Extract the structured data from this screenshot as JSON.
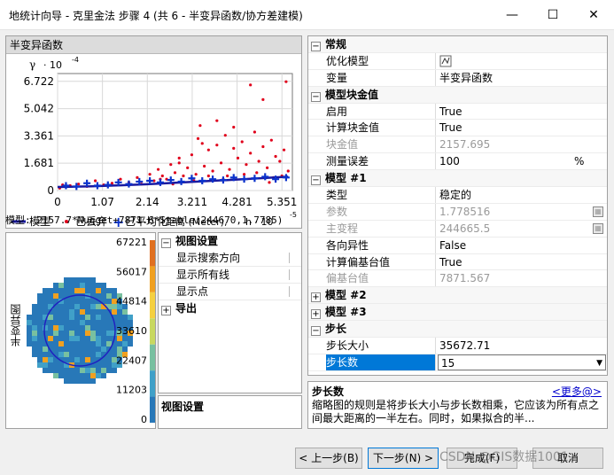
{
  "window": {
    "title": "地统计向导 - 克里金法 步骤 4 (共 6 - 半变异函数/协方差建模)",
    "minimize_icon": "minimize-icon",
    "maximize_icon": "maximize-icon",
    "close_icon": "close-icon"
  },
  "semivariogram": {
    "header": "半变异函数",
    "y_axis_label": "γ",
    "y_scale_label": "· 10",
    "y_scale_exp": "-4",
    "x_scale_label": "h · 10",
    "x_scale_exp": "-5",
    "legend": {
      "model": "模型",
      "discarded": "已丢弃",
      "averaged": "已平均化",
      "distance": "距离 (Meter),"
    },
    "model_formula": "模型: 2157.7*Nugget+7871.6*Stable(244670,1.7785)"
  },
  "chart_data": {
    "type": "scatter",
    "x_ticks": [
      "0",
      "1.07",
      "2.14",
      "3.211",
      "4.281",
      "5.351"
    ],
    "y_ticks": [
      "0",
      "1.681",
      "3.361",
      "5.042",
      "6.722"
    ],
    "xlim": [
      0,
      5.6
    ],
    "ylim": [
      0,
      7.2
    ],
    "series": [
      {
        "name": "模型",
        "color": "#1a1aa0",
        "kind": "line",
        "x": [
          0,
          0.3,
          0.8,
          1.5,
          2.2,
          3.0,
          3.8,
          4.6,
          5.5
        ],
        "y": [
          0.22,
          0.23,
          0.26,
          0.32,
          0.4,
          0.5,
          0.61,
          0.72,
          0.85
        ]
      },
      {
        "name": "已丢弃",
        "color": "#e0001b",
        "kind": "point",
        "x": [
          0.05,
          0.12,
          0.3,
          0.5,
          0.7,
          0.9,
          1.1,
          1.3,
          1.5,
          1.7,
          1.9,
          2.0,
          2.2,
          2.3,
          2.4,
          2.5,
          2.6,
          2.7,
          2.8,
          2.9,
          3.0,
          3.1,
          3.2,
          3.3,
          3.35,
          3.4,
          3.5,
          3.6,
          3.7,
          3.8,
          3.9,
          4.0,
          4.1,
          4.2,
          4.3,
          4.4,
          4.5,
          4.6,
          4.7,
          4.8,
          4.9,
          5.0,
          5.1,
          5.2,
          5.3,
          5.4,
          5.5,
          3.45,
          4.6,
          4.9,
          5.45,
          3.8,
          4.2,
          2.9,
          3.6,
          4.75,
          5.15,
          2.45,
          3.25,
          4.05,
          4.45,
          5.05,
          5.35,
          2.75,
          3.95
        ],
        "y": [
          0.15,
          0.35,
          0.3,
          0.4,
          0.25,
          0.6,
          0.35,
          0.45,
          0.7,
          0.5,
          0.8,
          0.4,
          1.0,
          0.6,
          1.3,
          0.9,
          0.7,
          1.6,
          1.1,
          2.0,
          0.9,
          1.4,
          2.2,
          1.0,
          3.2,
          4.0,
          1.5,
          2.5,
          1.2,
          2.8,
          1.7,
          3.4,
          1.3,
          2.6,
          2.0,
          3.0,
          1.6,
          2.3,
          3.6,
          1.8,
          2.7,
          1.4,
          3.1,
          2.1,
          1.8,
          2.5,
          1.2,
          2.9,
          6.5,
          5.6,
          6.7,
          4.3,
          3.9,
          1.7,
          0.9,
          1.1,
          0.8,
          0.7,
          0.6,
          0.9,
          1.0,
          0.5,
          0.9,
          0.4,
          0.7
        ]
      },
      {
        "name": "已平均化",
        "color": "#0b33cc",
        "kind": "plus",
        "x": [
          0.2,
          0.45,
          0.7,
          0.95,
          1.2,
          1.45,
          1.7,
          1.95,
          2.2,
          2.45,
          2.7,
          2.95,
          3.2,
          3.45,
          3.7,
          3.95,
          4.2,
          4.45,
          4.7,
          4.95,
          5.2,
          5.45
        ],
        "y": [
          0.3,
          0.25,
          0.45,
          0.3,
          0.35,
          0.5,
          0.4,
          0.55,
          0.6,
          0.5,
          0.65,
          0.55,
          0.75,
          0.6,
          0.7,
          0.65,
          0.8,
          0.7,
          0.75,
          0.85,
          0.7,
          0.8
        ]
      }
    ]
  },
  "map": {
    "vertical_label": "半变异图",
    "scale_values": [
      "67221",
      "56017",
      "44814",
      "33610",
      "22407",
      "11203",
      "0"
    ],
    "colors": [
      "#e07020",
      "#f0a020",
      "#f5d040",
      "#c8d860",
      "#78c0a0",
      "#40a0c8",
      "#2878b8"
    ]
  },
  "view_settings": {
    "section": "视图设置",
    "items": [
      "显示搜索方向",
      "显示所有线",
      "显示点"
    ],
    "export": "导出",
    "description_title": "视图设置"
  },
  "properties": {
    "general": "常规",
    "optimize_model": "优化模型",
    "optimize_icon": "optimize-icon",
    "variable": "变量",
    "variable_value": "半变异函数",
    "nugget_section": "模型块金值",
    "enable": "启用",
    "enable_value": "True",
    "calc_nugget": "计算块金值",
    "calc_nugget_value": "True",
    "nugget": "块金值",
    "nugget_value": "2157.695",
    "meas_error": "测量误差",
    "meas_error_value": "100",
    "meas_error_unit": "%",
    "model1": "模型 #1",
    "type": "类型",
    "type_value": "稳定的",
    "param": "参数",
    "param_value": "1.778516",
    "major_range": "主变程",
    "major_range_value": "244665.5",
    "anisotropy": "各向异性",
    "anisotropy_value": "False",
    "calc_partial_sill": "计算偏基台值",
    "calc_partial_sill_value": "True",
    "partial_sill": "偏基台值",
    "partial_sill_value": "7871.567",
    "model2": "模型 #2",
    "model3": "模型 #3",
    "lag": "步长",
    "lag_size": "步长大小",
    "lag_size_value": "35672.71",
    "lag_count": "步长数",
    "lag_count_value": "15"
  },
  "help": {
    "title": "步长数",
    "more": "<更多@>",
    "text": "缩略图的规则是将步长大小与步长数相乘，它应该为所有点之间最大距离的一半左右。同时，如果拟合的半..."
  },
  "buttons": {
    "back": "< 上一步(B)",
    "next": "下一步(N) >",
    "finish": "完成(F)",
    "cancel": "取消"
  },
  "watermark": "CSDN @GIS数据1001"
}
